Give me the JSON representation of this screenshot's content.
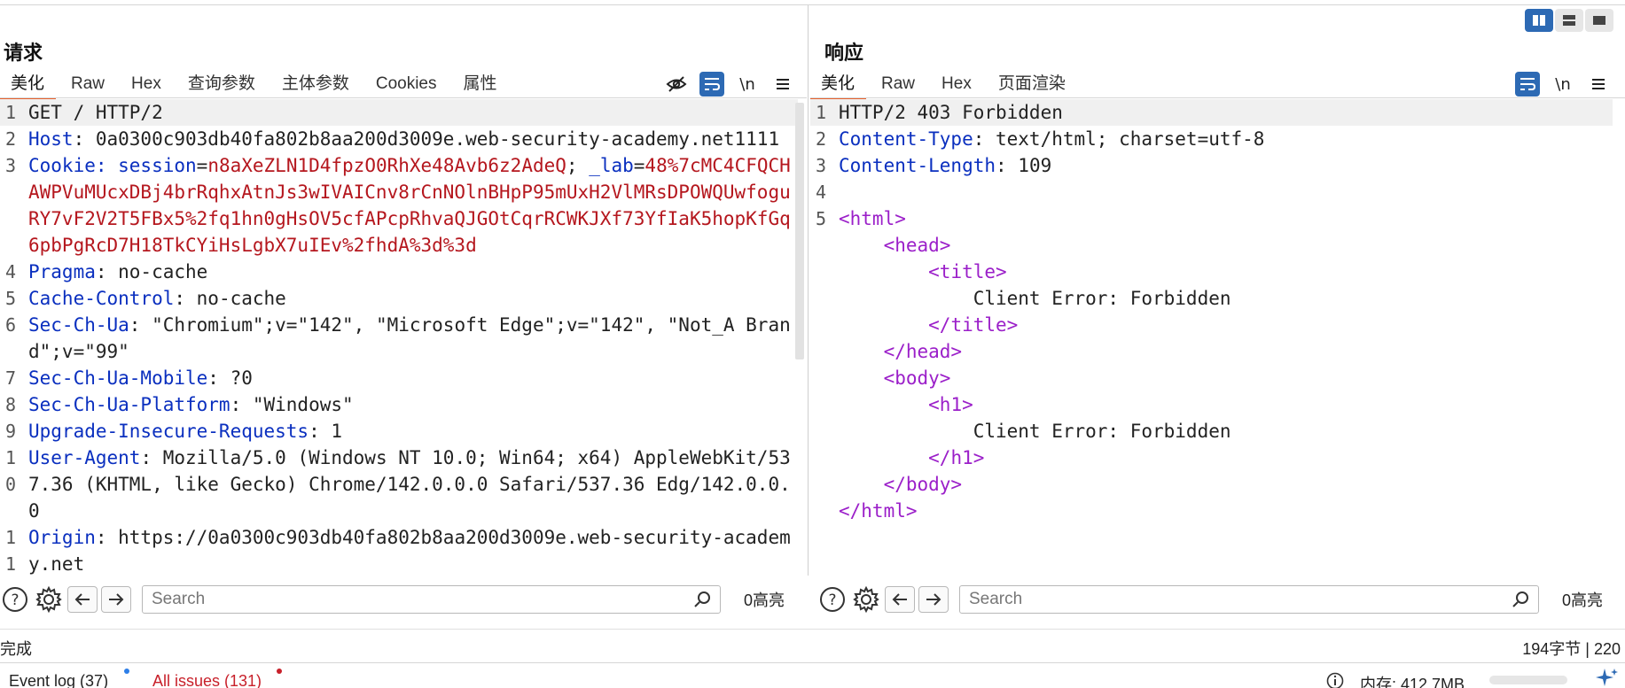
{
  "layout_toggle": [
    "horizontal-split-icon",
    "vertical-split-icon",
    "single-pane-icon"
  ],
  "colors": {
    "accent": "#e8612c",
    "active_tool": "#2d6ab4",
    "header_name": "#0a2fbf",
    "cookie_value": "#b5171e",
    "html_tag": "#9b1fc9"
  },
  "request": {
    "title": "请求",
    "tabs": [
      "美化",
      "Raw",
      "Hex",
      "查询参数",
      "主体参数",
      "Cookies",
      "属性"
    ],
    "lines": [
      {
        "n": "1",
        "plain": "GET / HTTP/2"
      },
      {
        "n": "2",
        "name": "Host",
        "value": ": 0a0300c903db40fa802b8aa200d3009e.web-security-academy.net1111"
      },
      {
        "n": "3",
        "name": "Cookie",
        "cookie_name1": ": session",
        "eq1": "=",
        "cookie_val1": "n8aXeZLN1D4fpzO0RhXe48Avb6z2AdeQ",
        "sep": "; ",
        "cookie_name2": "_lab",
        "eq2": "=",
        "cookie_val2": "48%7cMC4CFQCHAWPVuMUcxDBj4brRqhxAtnJs3wIVAICnv8rCnNOlnBHpP95mUxH2VlMRsDPOWQUwfoguRY7vF2V2T5FBx5%2fq1hn0gHsOV5cfAPcpRhvaQJGOtCqrRCWKJXf73YfIaK5hopKfGq6pbPgRcD7H18TkCYiHsLgbX7uIEv%2fhdA%3d%3d"
      },
      {
        "n": "4",
        "name": "Pragma",
        "value": ": no-cache"
      },
      {
        "n": "5",
        "name": "Cache-Control",
        "value": ": no-cache"
      },
      {
        "n": "6",
        "name": "Sec-Ch-Ua",
        "value": ": \"Chromium\";v=\"142\", \"Microsoft Edge\";v=\"142\", \"Not_A Brand\";v=\"99\""
      },
      {
        "n": "7",
        "name": "Sec-Ch-Ua-Mobile",
        "value": ": ?0"
      },
      {
        "n": "8",
        "name": "Sec-Ch-Ua-Platform",
        "value": ": \"Windows\""
      },
      {
        "n": "9",
        "name": "Upgrade-Insecure-Requests",
        "value": ": 1"
      },
      {
        "n": "10",
        "name": "User-Agent",
        "value": ": Mozilla/5.0 (Windows NT 10.0; Win64; x64) AppleWebKit/537.36 (KHTML, like Gecko) Chrome/142.0.0.0 Safari/537.36 Edg/142.0.0.0"
      },
      {
        "n": "11",
        "name": "Origin",
        "value": ": https://0a0300c903db40fa802b8aa200d3009e.web-security-academy.net"
      }
    ],
    "search_placeholder": "Search",
    "highlight_count": "0高亮"
  },
  "response": {
    "title": "响应",
    "tabs": [
      "美化",
      "Raw",
      "Hex",
      "页面渲染"
    ],
    "lines": [
      {
        "n": "1",
        "plain": "HTTP/2 403 Forbidden"
      },
      {
        "n": "2",
        "name": "Content-Type",
        "value": ": text/html; charset=utf-8"
      },
      {
        "n": "3",
        "name": "Content-Length",
        "value": ": 109"
      },
      {
        "n": "4",
        "plain": ""
      },
      {
        "n": "5",
        "tag": "<html>"
      },
      {
        "indent": "    ",
        "tag": "<head>"
      },
      {
        "indent": "        ",
        "tag": "<title>"
      },
      {
        "indent": "            ",
        "plain": "Client Error: Forbidden"
      },
      {
        "indent": "        ",
        "tag": "</title>"
      },
      {
        "indent": "    ",
        "tag": "</head>"
      },
      {
        "indent": "    ",
        "tag": "<body>"
      },
      {
        "indent": "        ",
        "tag": "<h1>"
      },
      {
        "indent": "            ",
        "plain": "Client Error: Forbidden"
      },
      {
        "indent": "        ",
        "tag": "</h1>"
      },
      {
        "indent": "    ",
        "tag": "</body>"
      },
      {
        "tag": "</html>"
      }
    ],
    "search_placeholder": "Search",
    "highlight_count": "0高亮"
  },
  "status": {
    "left": "完成",
    "right": "194字节 | 220"
  },
  "bottom": {
    "event_log": "Event log (37)",
    "all_issues": "All issues (131)",
    "memory": "内存: 412.7MB"
  }
}
